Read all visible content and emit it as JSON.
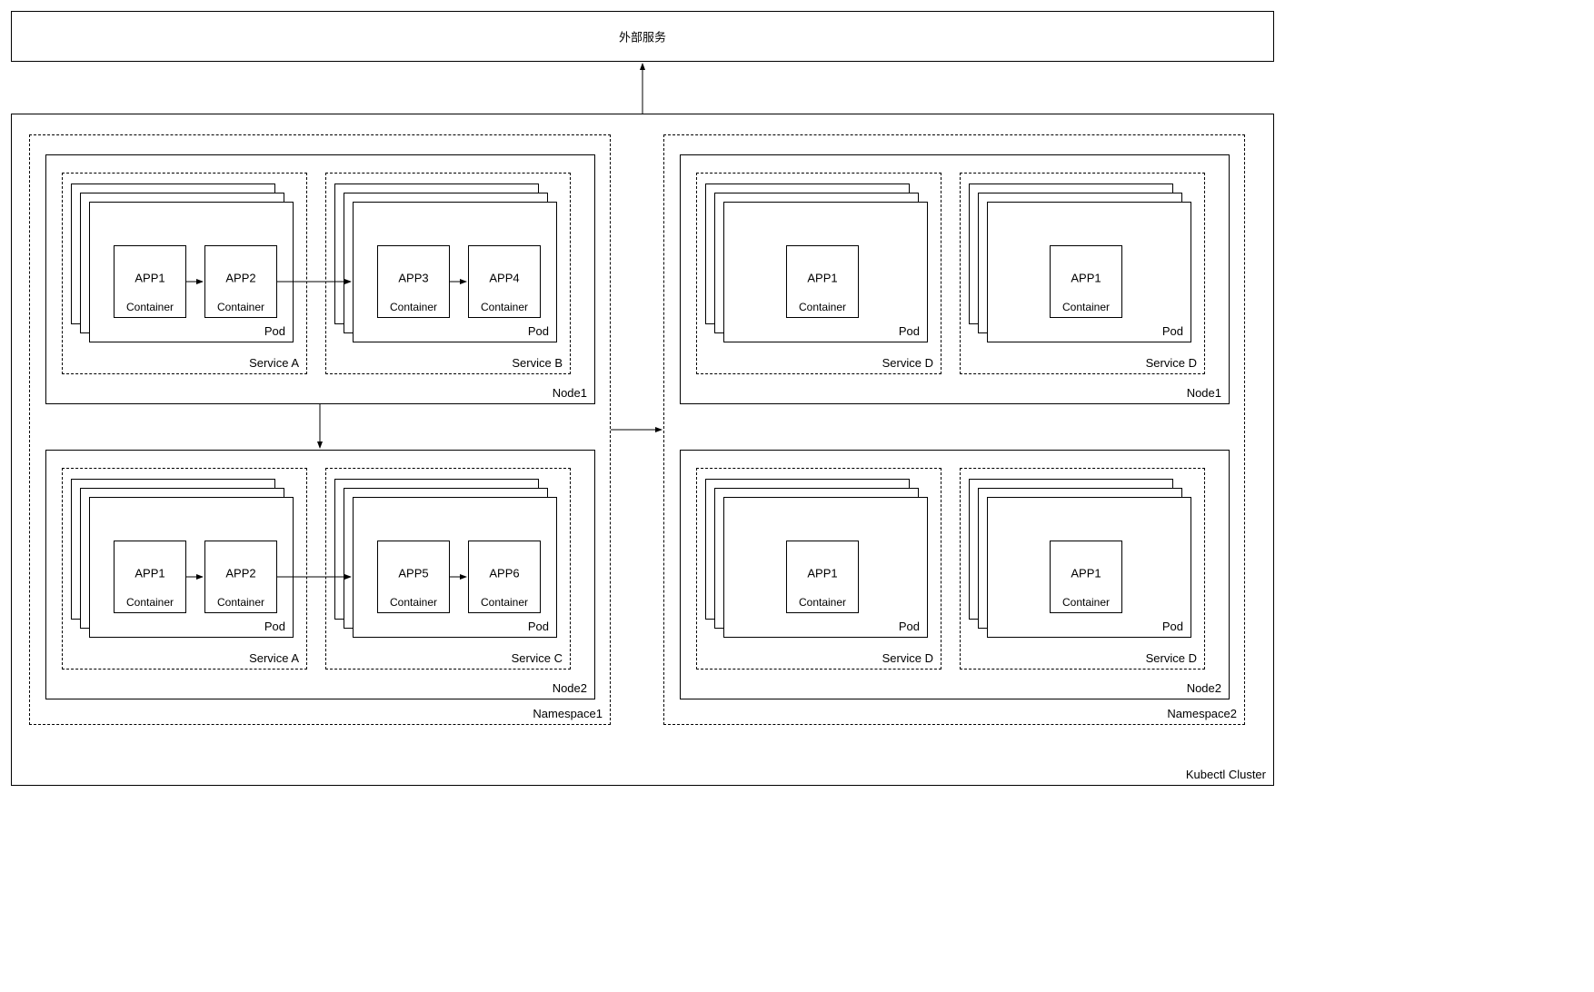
{
  "external": "外部服务",
  "cluster": "Kubectl Cluster",
  "namespace1": "Namespace1",
  "namespace2": "Namespace2",
  "node1": "Node1",
  "node2": "Node2",
  "serviceA": "Service A",
  "serviceB": "Service B",
  "serviceC": "Service C",
  "serviceD": "Service D",
  "pod": "Pod",
  "container": "Container",
  "app1": "APP1",
  "app2": "APP2",
  "app3": "APP3",
  "app4": "APP4",
  "app5": "APP5",
  "app6": "APP6"
}
